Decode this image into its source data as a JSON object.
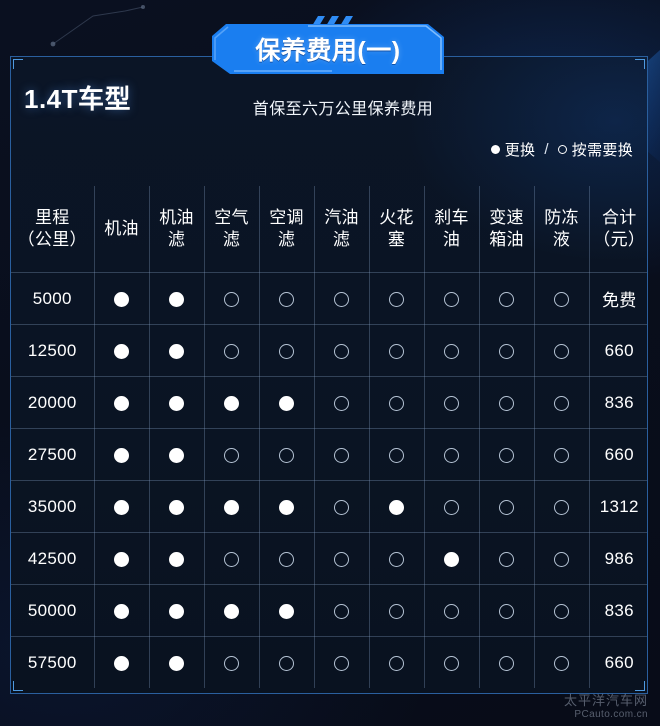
{
  "banner": {
    "title": "保养费用(一)",
    "accent_color": "#1a7ef0"
  },
  "header": {
    "model_title": "1.4T车型",
    "subtitle": "首保至六万公里保养费用"
  },
  "legend": {
    "filled_label": "更换",
    "separator": "/",
    "hollow_label": "按需要换"
  },
  "table": {
    "columns": [
      {
        "key": "km",
        "line1": "里程",
        "line2": "（公里）",
        "accent": false
      },
      {
        "key": "oil",
        "line1": "机油",
        "line2": "",
        "accent": false
      },
      {
        "key": "oilfil",
        "line1": "机油",
        "line2": "滤",
        "accent": false
      },
      {
        "key": "airfil",
        "line1": "空气",
        "line2": "滤",
        "accent": false
      },
      {
        "key": "acfil",
        "line1": "空调",
        "line2": "滤",
        "accent": false
      },
      {
        "key": "fuelfil",
        "line1": "汽油",
        "line2": "滤",
        "accent": false
      },
      {
        "key": "plug",
        "line1": "火花",
        "line2": "塞",
        "accent": false
      },
      {
        "key": "brake",
        "line1": "刹车",
        "line2": "油",
        "accent": false
      },
      {
        "key": "trans",
        "line1": "变速",
        "line2": "箱油",
        "accent": false
      },
      {
        "key": "coolant",
        "line1": "防冻",
        "line2": "液",
        "accent": false
      },
      {
        "key": "total",
        "line1": "合计",
        "line2": "（元）",
        "accent": true
      }
    ],
    "rows": [
      {
        "km": "5000",
        "marks": [
          "filled",
          "filled",
          "hollow",
          "hollow",
          "hollow",
          "hollow",
          "hollow",
          "hollow",
          "hollow"
        ],
        "total": "免费"
      },
      {
        "km": "12500",
        "marks": [
          "filled",
          "filled",
          "hollow",
          "hollow",
          "hollow",
          "hollow",
          "hollow",
          "hollow",
          "hollow"
        ],
        "total": "660"
      },
      {
        "km": "20000",
        "marks": [
          "filled",
          "filled",
          "filled",
          "filled",
          "hollow",
          "hollow",
          "hollow",
          "hollow",
          "hollow"
        ],
        "total": "836"
      },
      {
        "km": "27500",
        "marks": [
          "filled",
          "filled",
          "hollow",
          "hollow",
          "hollow",
          "hollow",
          "hollow",
          "hollow",
          "hollow"
        ],
        "total": "660"
      },
      {
        "km": "35000",
        "marks": [
          "filled",
          "filled",
          "filled",
          "filled",
          "hollow",
          "filled",
          "hollow",
          "hollow",
          "hollow"
        ],
        "total": "1312"
      },
      {
        "km": "42500",
        "marks": [
          "filled",
          "filled",
          "hollow",
          "hollow",
          "hollow",
          "hollow",
          "filled",
          "hollow",
          "hollow"
        ],
        "total": "986"
      },
      {
        "km": "50000",
        "marks": [
          "filled",
          "filled",
          "filled",
          "filled",
          "hollow",
          "hollow",
          "hollow",
          "hollow",
          "hollow"
        ],
        "total": "836"
      },
      {
        "km": "57500",
        "marks": [
          "filled",
          "filled",
          "hollow",
          "hollow",
          "hollow",
          "hollow",
          "hollow",
          "hollow",
          "hollow"
        ],
        "total": "660"
      }
    ]
  },
  "watermark": {
    "cn": "太平洋汽车网",
    "en": "PCauto.com.cn"
  },
  "colors": {
    "accent_orange": "#e8552f",
    "panel_border": "#2a5f9e",
    "background": "#0a1020"
  }
}
